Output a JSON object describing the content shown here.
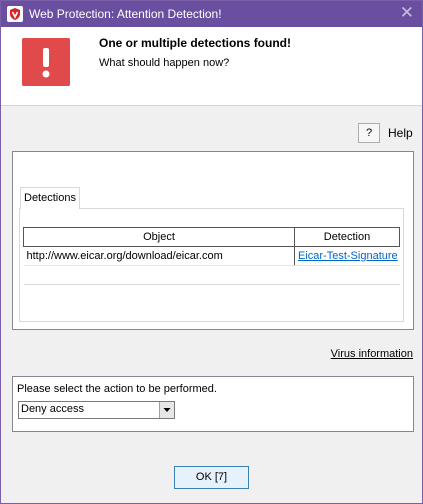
{
  "window": {
    "title": "Web Protection: Attention Detection!",
    "accent_color": "#6a4fa0",
    "app_icon": "shield-icon",
    "close_icon": "close-icon"
  },
  "header": {
    "heading": "One or multiple detections found!",
    "subheading": "What should happen now?",
    "alert_icon": "exclamation-icon",
    "alert_color": "#e04a4a"
  },
  "help": {
    "icon_glyph": "?",
    "label": "Help"
  },
  "detections": {
    "tab_label": "Detections",
    "columns": [
      "Object",
      "Detection"
    ],
    "rows": [
      {
        "object": "http://www.eicar.org/download/eicar.com",
        "detection": "Eicar-Test-Signature"
      }
    ]
  },
  "virus_info_link": "Virus information",
  "action": {
    "prompt": "Please select the action to be performed.",
    "selected": "Deny access"
  },
  "ok_button": "OK [7]"
}
